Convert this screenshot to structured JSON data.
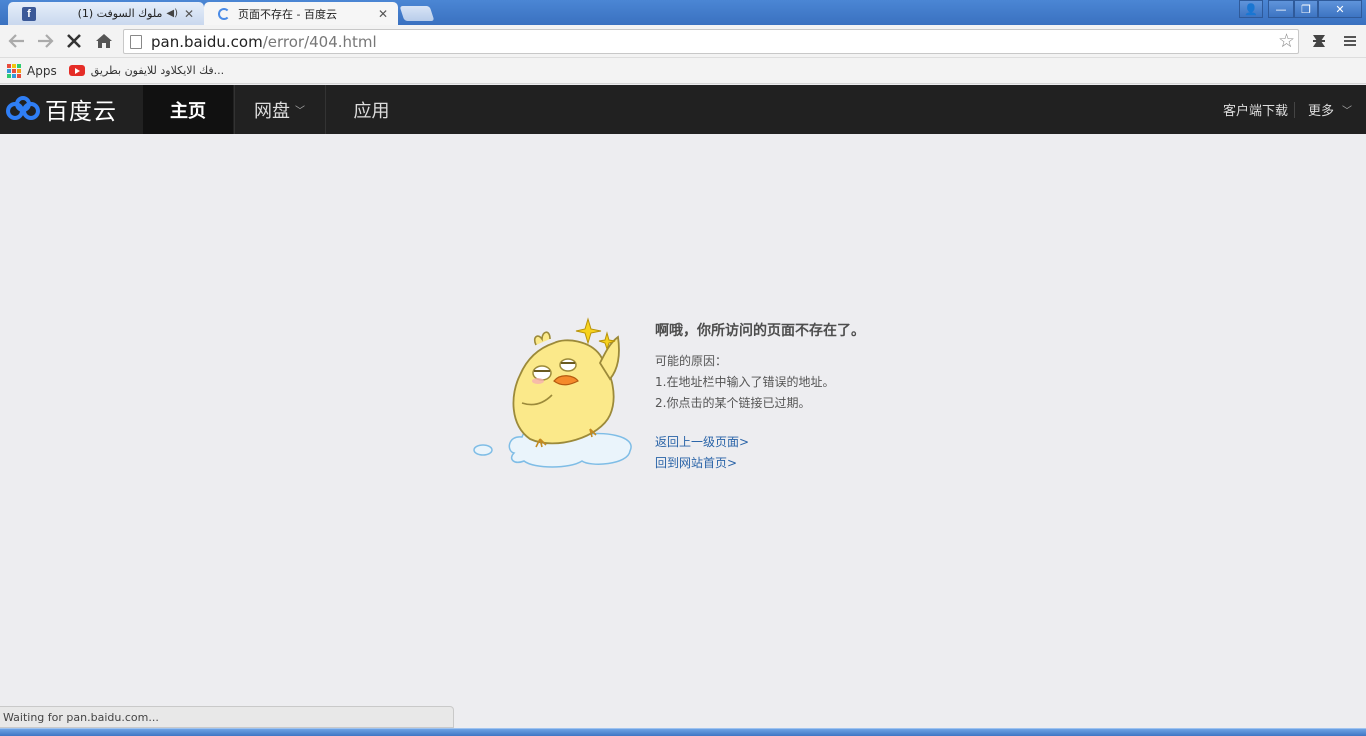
{
  "browser": {
    "tabs": [
      {
        "title": "(1) ملوك السوفت",
        "favicon": "facebook-icon",
        "state": "inactive"
      },
      {
        "title": "页面不存在 - 百度云",
        "favicon": "loading-spinner-icon",
        "state": "active"
      }
    ],
    "address": {
      "domain": "pan.baidu.com",
      "path": "/error/404.html"
    },
    "bookmarks": [
      {
        "label": "Apps",
        "icon": "apps-grid-icon"
      },
      {
        "label": "فك الايكلاود للايفون بطريق...",
        "icon": "youtube-icon"
      }
    ],
    "status_text": "Waiting for pan.baidu.com..."
  },
  "header": {
    "logo_text": "百度云",
    "nav": [
      {
        "label": "主页",
        "active": true
      },
      {
        "label": "网盘",
        "active": false
      },
      {
        "label": "应用",
        "active": false
      }
    ],
    "right": {
      "download": "客户端下载",
      "more": "更多"
    }
  },
  "error": {
    "title": "啊哦，你所访问的页面不存在了。",
    "reason_heading": "可能的原因：",
    "reasons": [
      "1.在地址栏中输入了错误的地址。",
      "2.你点击的某个链接已过期。"
    ],
    "links": [
      "返回上一级页面>",
      "回到网站首页>"
    ]
  },
  "colors": {
    "header_bg": "#212121",
    "nav_active_bg": "#111111",
    "page_bg": "#ededf0",
    "link": "#2a64a8",
    "chrome_blue": "#3a71c0"
  }
}
